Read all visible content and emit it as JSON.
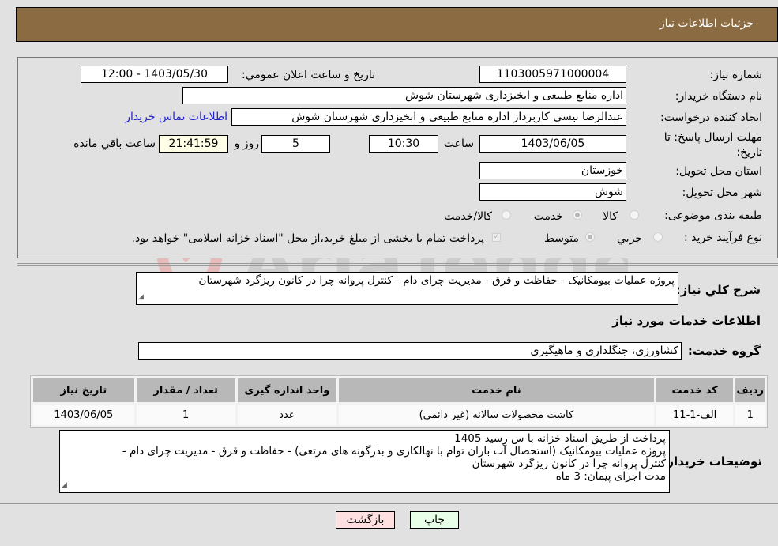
{
  "header": {
    "title": "جزئیات اطلاعات نیاز"
  },
  "form": {
    "need_number": {
      "label": "شماره نیاز:",
      "value": "1103005971000004"
    },
    "announce_datetime": {
      "label": "تاریخ و ساعت اعلان عمومي:",
      "value": "1403/05/30 - 12:00"
    },
    "buyer_org": {
      "label": "نام دستگاه خریدار:",
      "value": "اداره منابع طبیعی و ابخیزداری شهرستان شوش"
    },
    "requester": {
      "label": "ایجاد کننده درخواست:",
      "value": "عبدالرضا نیسی کاربرداز اداره منابع طبیعی و ابخیزداری شهرستان شوش",
      "contact_link": "اطلاعات تماس خریدار"
    },
    "deadline": {
      "label": "مهلت ارسال پاسخ: تا تاریخ:",
      "date": "1403/06/05",
      "time_label": "ساعت",
      "time": "10:30",
      "days": "5",
      "days_label": "روز و",
      "remaining": "21:41:59",
      "remaining_label": "ساعت باقي مانده"
    },
    "province": {
      "label": "استان محل تحویل:",
      "value": "خوزستان"
    },
    "city": {
      "label": "شهر محل تحویل:",
      "value": "شوش"
    },
    "category": {
      "label": "طبقه بندی موضوعی:",
      "options": [
        "کالا",
        "خدمت",
        "کالا/خدمت"
      ],
      "selected": "خدمت"
    },
    "purchase_type": {
      "label": "نوع فرآیند خرید :",
      "options": [
        "جزيي",
        "متوسط"
      ],
      "selected": "متوسط",
      "treasury_note": "پرداخت تمام یا بخشی از مبلغ خرید،از محل \"اسناد خزانه اسلامی\" خواهد بود.",
      "treasury_checked": true
    }
  },
  "summary": {
    "label": "شرح كلي نیاز:",
    "value": "پروژه عملیات بیومکانیک  - حفاظت و قرق - مدیریت چرای دام - کنترل پروانه چرا در کانون ریزگرد شهرستان"
  },
  "services": {
    "section_title": "اطلاعات خدمات مورد نیاز",
    "group_label": "گروه خدمت:",
    "group_value": "کشاورزی، جنگلداری و ماهیگیری",
    "table": {
      "columns": [
        "ردیف",
        "کد خدمت",
        "نام خدمت",
        "واحد اندازه گیری",
        "تعداد / مقدار",
        "تاریخ نیاز"
      ],
      "rows": [
        [
          "1",
          "الف-1-11",
          "کاشت محصولات سالانه (غیر دائمی)",
          "عدد",
          "1",
          "1403/06/05"
        ]
      ]
    }
  },
  "buyer_notes": {
    "label": "توضیحات خریدار:",
    "lines": [
      "پرداخت از طریق اسناد خزانه با س رسید 1405",
      "پروژه عملیات بیومکانیک (استحصال آب باران توام با نهالکاری و بذرگونه های مرتعی) - حفاظت و قرق - مدیریت چرای دام -",
      "کنترل پروانه چرا در کانون ریزگرد شهرستان",
      "مدت اجرای پیمان: 3 ماه"
    ]
  },
  "buttons": {
    "print": "چاپ",
    "back": "بازگشت"
  },
  "colors": {
    "header_bg": "#8b6c42",
    "back_btn_bg": "#ffe0e0",
    "print_btn_bg": "#e8ffe8",
    "remaining_bg": "#ffffe8",
    "link": "#2222cc"
  },
  "watermark": {
    "text": "AriaTender.neT"
  }
}
